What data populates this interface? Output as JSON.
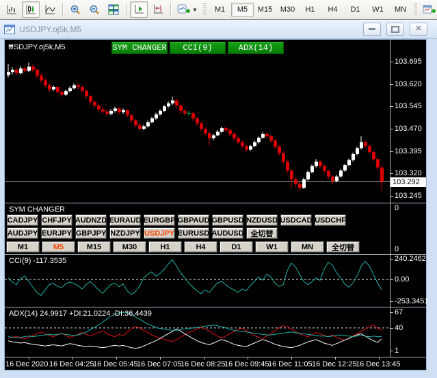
{
  "toolbar": {
    "chart_type": [
      "bars",
      "candlesticks",
      "line"
    ],
    "chart_type_active": "candlesticks",
    "timeframes": [
      "M1",
      "M5",
      "M15",
      "M30",
      "H1",
      "H4",
      "D1",
      "W1",
      "MN"
    ],
    "timeframe_active": "M5",
    "autoscroll_active": true
  },
  "window": {
    "title": "USDJPY.oj5k,M5"
  },
  "chart": {
    "symbol_label": "USDJPY.oj5k,M5",
    "header_buttons": [
      "SYM CHANGER",
      "CCI(9)",
      "ADX(14)"
    ],
    "price_axis": [
      "103.695",
      "103.620",
      "103.545",
      "103.470",
      "103.395",
      "103.320",
      "103.245"
    ],
    "current_price": "103.292",
    "time_axis": [
      "16 Dec 2020",
      "16 Dec 04:25",
      "16 Dec 05:45",
      "16 Dec 07:05",
      "16 Dec 08:25",
      "16 Dec 09:45",
      "16 Dec 11:05",
      "16 Dec 12:25",
      "16 Dec 13:45"
    ]
  },
  "sym_changer": {
    "title": "SYM CHANGER",
    "rows": [
      [
        "CADJPY",
        "CHFJPY",
        "AUDNZD",
        "EURAUD",
        "EURGBP",
        "GBPAUD",
        "GBPUSD",
        "NZDUSD",
        "USDCAD",
        "USDCHF"
      ],
      [
        "AUDJPY",
        "EURJPY",
        "GBPJPY",
        "NZDJPY",
        "USDJPY",
        "EURUSD",
        "AUDUSD",
        "全切替"
      ],
      [
        "M1",
        "M5",
        "M15",
        "M30",
        "H1",
        "H4",
        "D1",
        "W1",
        "MN",
        "全切替"
      ]
    ],
    "highlighted": [
      "USDJPY",
      "M5"
    ],
    "axis": [
      "0",
      "0"
    ]
  },
  "cci": {
    "label": "CCI(9) -117.3535",
    "axis": [
      "240.2462",
      "0.00",
      "-253.3451"
    ],
    "zero_level": "0.00"
  },
  "adx": {
    "label": "ADX(14) 24.9917 +DI:21.0224 -DI:36.4439",
    "axis": [
      "67",
      "40",
      "1"
    ],
    "level": "40"
  },
  "chart_data": {
    "type": "candlestick",
    "symbol": "USDJPY.oj5k",
    "period": "M5",
    "ylim": [
      103.245,
      103.695
    ],
    "current_price": 103.292,
    "colors": {
      "up": "#ffffff",
      "down": "#dd0000",
      "marker": "#00a550",
      "price_line": "#95a8b8",
      "cci": "#20b2aa",
      "adx": "#20b2aa",
      "plus_di": "#ffffff",
      "minus_di": "#e01010"
    },
    "green_marker_index": 44,
    "candles_ohlc": [
      [
        103.65,
        103.688,
        103.642,
        103.66
      ],
      [
        103.66,
        103.676,
        103.652,
        103.668
      ],
      [
        103.668,
        103.674,
        103.65,
        103.656
      ],
      [
        103.656,
        103.68,
        103.652,
        103.672
      ],
      [
        103.672,
        103.678,
        103.658,
        103.664
      ],
      [
        103.664,
        103.692,
        103.66,
        103.678
      ],
      [
        103.678,
        103.685,
        103.66,
        103.668
      ],
      [
        103.668,
        103.673,
        103.64,
        103.648
      ],
      [
        103.648,
        103.656,
        103.624,
        103.632
      ],
      [
        103.632,
        103.64,
        103.608,
        103.616
      ],
      [
        103.616,
        103.624,
        103.594,
        103.602
      ],
      [
        103.602,
        103.616,
        103.596,
        103.61
      ],
      [
        103.61,
        103.614,
        103.586,
        103.593
      ],
      [
        103.593,
        103.6,
        103.576,
        103.584
      ],
      [
        103.584,
        103.602,
        103.58,
        103.596
      ],
      [
        103.596,
        103.612,
        103.592,
        103.606
      ],
      [
        103.606,
        103.622,
        103.602,
        103.616
      ],
      [
        103.616,
        103.624,
        103.602,
        103.61
      ],
      [
        103.61,
        103.615,
        103.59,
        103.597
      ],
      [
        103.597,
        103.603,
        103.572,
        103.58
      ],
      [
        103.58,
        103.585,
        103.552,
        103.56
      ],
      [
        103.56,
        103.566,
        103.54,
        103.548
      ],
      [
        103.548,
        103.554,
        103.528,
        103.535
      ],
      [
        103.535,
        103.542,
        103.52,
        103.528
      ],
      [
        103.528,
        103.534,
        103.512,
        103.52
      ],
      [
        103.52,
        103.536,
        103.515,
        103.53
      ],
      [
        103.53,
        103.544,
        103.524,
        103.538
      ],
      [
        103.538,
        103.542,
        103.518,
        103.525
      ],
      [
        103.525,
        103.538,
        103.52,
        103.532
      ],
      [
        103.532,
        103.536,
        103.508,
        103.515
      ],
      [
        103.515,
        103.52,
        103.49,
        103.498
      ],
      [
        103.498,
        103.504,
        103.474,
        103.482
      ],
      [
        103.482,
        103.488,
        103.462,
        103.47
      ],
      [
        103.47,
        103.484,
        103.465,
        103.478
      ],
      [
        103.478,
        103.498,
        103.474,
        103.492
      ],
      [
        103.492,
        103.51,
        103.488,
        103.505
      ],
      [
        103.505,
        103.524,
        103.5,
        103.518
      ],
      [
        103.518,
        103.536,
        103.514,
        103.53
      ],
      [
        103.53,
        103.55,
        103.526,
        103.545
      ],
      [
        103.545,
        103.562,
        103.54,
        103.555
      ],
      [
        103.555,
        103.578,
        103.55,
        103.565
      ],
      [
        103.565,
        103.57,
        103.54,
        103.548
      ],
      [
        103.548,
        103.554,
        103.522,
        103.53
      ],
      [
        103.53,
        103.536,
        103.514,
        103.522
      ],
      [
        103.522,
        103.53,
        103.514,
        103.522
      ],
      [
        103.522,
        103.526,
        103.498,
        103.505
      ],
      [
        103.505,
        103.51,
        103.48,
        103.488
      ],
      [
        103.488,
        103.494,
        103.462,
        103.47
      ],
      [
        103.47,
        103.476,
        103.446,
        103.455
      ],
      [
        103.455,
        103.46,
        103.415,
        103.438
      ],
      [
        103.438,
        103.452,
        103.432,
        103.448
      ],
      [
        103.448,
        103.466,
        103.444,
        103.46
      ],
      [
        103.46,
        103.478,
        103.456,
        103.472
      ],
      [
        103.472,
        103.478,
        103.458,
        103.465
      ],
      [
        103.465,
        103.47,
        103.445,
        103.452
      ],
      [
        103.452,
        103.458,
        103.43,
        103.438
      ],
      [
        103.438,
        103.444,
        103.418,
        103.425
      ],
      [
        103.425,
        103.43,
        103.404,
        103.412
      ],
      [
        103.412,
        103.418,
        103.392,
        103.4
      ],
      [
        103.4,
        103.416,
        103.396,
        103.412
      ],
      [
        103.412,
        103.43,
        103.408,
        103.425
      ],
      [
        103.425,
        103.444,
        103.42,
        103.44
      ],
      [
        103.44,
        103.458,
        103.436,
        103.452
      ],
      [
        103.452,
        103.458,
        103.438,
        103.445
      ],
      [
        103.445,
        103.45,
        103.422,
        103.43
      ],
      [
        103.43,
        103.436,
        103.402,
        103.41
      ],
      [
        103.41,
        103.415,
        103.38,
        103.388
      ],
      [
        103.388,
        103.394,
        103.35,
        103.36
      ],
      [
        103.36,
        103.366,
        103.32,
        103.33
      ],
      [
        103.33,
        103.336,
        103.272,
        103.3
      ],
      [
        103.3,
        103.308,
        103.275,
        103.285
      ],
      [
        103.285,
        103.295,
        103.262,
        103.272
      ],
      [
        103.272,
        103.305,
        103.268,
        103.3
      ],
      [
        103.3,
        103.33,
        103.296,
        103.325
      ],
      [
        103.325,
        103.35,
        103.32,
        103.345
      ],
      [
        103.345,
        103.368,
        103.34,
        103.36
      ],
      [
        103.36,
        103.365,
        103.338,
        103.345
      ],
      [
        103.345,
        103.35,
        103.32,
        103.328
      ],
      [
        103.328,
        103.334,
        103.302,
        103.31
      ],
      [
        103.31,
        103.316,
        103.284,
        103.295
      ],
      [
        103.295,
        103.315,
        103.29,
        103.31
      ],
      [
        103.31,
        103.335,
        103.306,
        103.33
      ],
      [
        103.33,
        103.352,
        103.326,
        103.348
      ],
      [
        103.348,
        103.37,
        103.344,
        103.365
      ],
      [
        103.365,
        103.39,
        103.36,
        103.385
      ],
      [
        103.385,
        103.41,
        103.38,
        103.405
      ],
      [
        103.405,
        103.445,
        103.4,
        103.425
      ],
      [
        103.425,
        103.43,
        103.405,
        103.412
      ],
      [
        103.412,
        103.418,
        103.385,
        103.392
      ],
      [
        103.392,
        103.398,
        103.36,
        103.368
      ],
      [
        103.368,
        103.374,
        103.332,
        103.34
      ],
      [
        103.34,
        103.346,
        103.262,
        103.292
      ]
    ],
    "cci": {
      "name": "CCI(9)",
      "last_value": -117.3535,
      "ylim": [
        -253.3451,
        240.2462
      ],
      "zero_level": 0,
      "values": [
        20,
        -30,
        -60,
        10,
        40,
        -20,
        -90,
        -150,
        -185,
        -120,
        -60,
        -45,
        -80,
        -95,
        -50,
        -30,
        -45,
        -70,
        -110,
        -60,
        -25,
        -70,
        -120,
        -160,
        -110,
        -60,
        -45,
        -85,
        -50,
        -130,
        -175,
        -140,
        -80,
        20,
        60,
        90,
        40,
        70,
        120,
        180,
        230,
        160,
        80,
        20,
        -40,
        -90,
        -130,
        -165,
        -120,
        -150,
        -90,
        -40,
        -20,
        -60,
        -95,
        -120,
        -150,
        -110,
        -130,
        -70,
        -20,
        30,
        -10,
        60,
        30,
        -40,
        -80,
        -60,
        100,
        190,
        150,
        60,
        -20,
        -60,
        -30,
        20,
        -10,
        120,
        200,
        170,
        80,
        20,
        -50,
        -90,
        -40,
        40,
        150,
        210,
        160,
        60,
        -40,
        -117.35
      ]
    },
    "adx": {
      "name": "ADX(14)",
      "adx_last": 24.9917,
      "plus_di_last": 21.0224,
      "minus_di_last": 36.4439,
      "ylim": [
        1,
        67
      ],
      "level": 40,
      "adx_values": [
        25,
        24,
        23,
        24,
        25,
        26,
        25,
        26,
        27,
        28,
        29,
        28,
        29,
        30,
        29,
        28,
        27,
        28,
        30,
        33,
        37,
        41,
        45,
        50,
        55,
        60,
        63,
        66,
        67,
        66,
        63,
        59,
        55,
        51,
        47,
        44,
        41,
        39,
        38,
        37,
        36,
        36,
        37,
        38,
        39,
        40,
        41,
        42,
        43,
        44,
        45,
        44,
        42,
        40,
        38,
        36,
        35,
        34,
        33,
        32,
        31,
        30,
        29,
        28,
        28,
        29,
        30,
        31,
        32,
        33,
        32,
        31,
        30,
        29,
        28,
        27,
        26,
        26,
        25,
        26,
        27,
        28,
        27,
        26,
        25,
        26,
        27,
        26,
        25,
        26,
        25,
        25
      ],
      "plus_di_values": [
        18,
        16,
        15,
        14,
        15,
        13,
        12,
        11,
        10,
        9,
        10,
        11,
        10,
        9,
        11,
        13,
        12,
        10,
        9,
        8,
        9,
        8,
        7,
        6,
        7,
        9,
        10,
        9,
        10,
        8,
        6,
        5,
        6,
        9,
        12,
        15,
        18,
        22,
        26,
        30,
        34,
        38,
        35,
        30,
        26,
        22,
        18,
        15,
        13,
        11,
        14,
        17,
        20,
        18,
        15,
        12,
        10,
        9,
        8,
        11,
        14,
        17,
        20,
        18,
        15,
        12,
        10,
        8,
        7,
        6,
        8,
        10,
        13,
        16,
        18,
        20,
        17,
        14,
        12,
        10,
        13,
        16,
        19,
        22,
        25,
        28,
        30,
        26,
        22,
        18,
        15,
        21
      ],
      "minus_di_values": [
        22,
        24,
        26,
        23,
        21,
        24,
        27,
        30,
        33,
        30,
        27,
        25,
        28,
        31,
        27,
        24,
        26,
        29,
        32,
        29,
        26,
        29,
        32,
        35,
        31,
        27,
        25,
        29,
        26,
        33,
        38,
        42,
        40,
        36,
        32,
        28,
        25,
        22,
        20,
        18,
        17,
        20,
        24,
        28,
        32,
        35,
        38,
        41,
        38,
        35,
        30,
        26,
        23,
        26,
        30,
        34,
        37,
        40,
        36,
        31,
        27,
        24,
        22,
        26,
        30,
        35,
        40,
        44,
        42,
        38,
        34,
        30,
        27,
        25,
        28,
        32,
        30,
        27,
        25,
        28,
        24,
        21,
        19,
        22,
        26,
        30,
        34,
        38,
        42,
        45,
        40,
        36.4
      ]
    }
  }
}
